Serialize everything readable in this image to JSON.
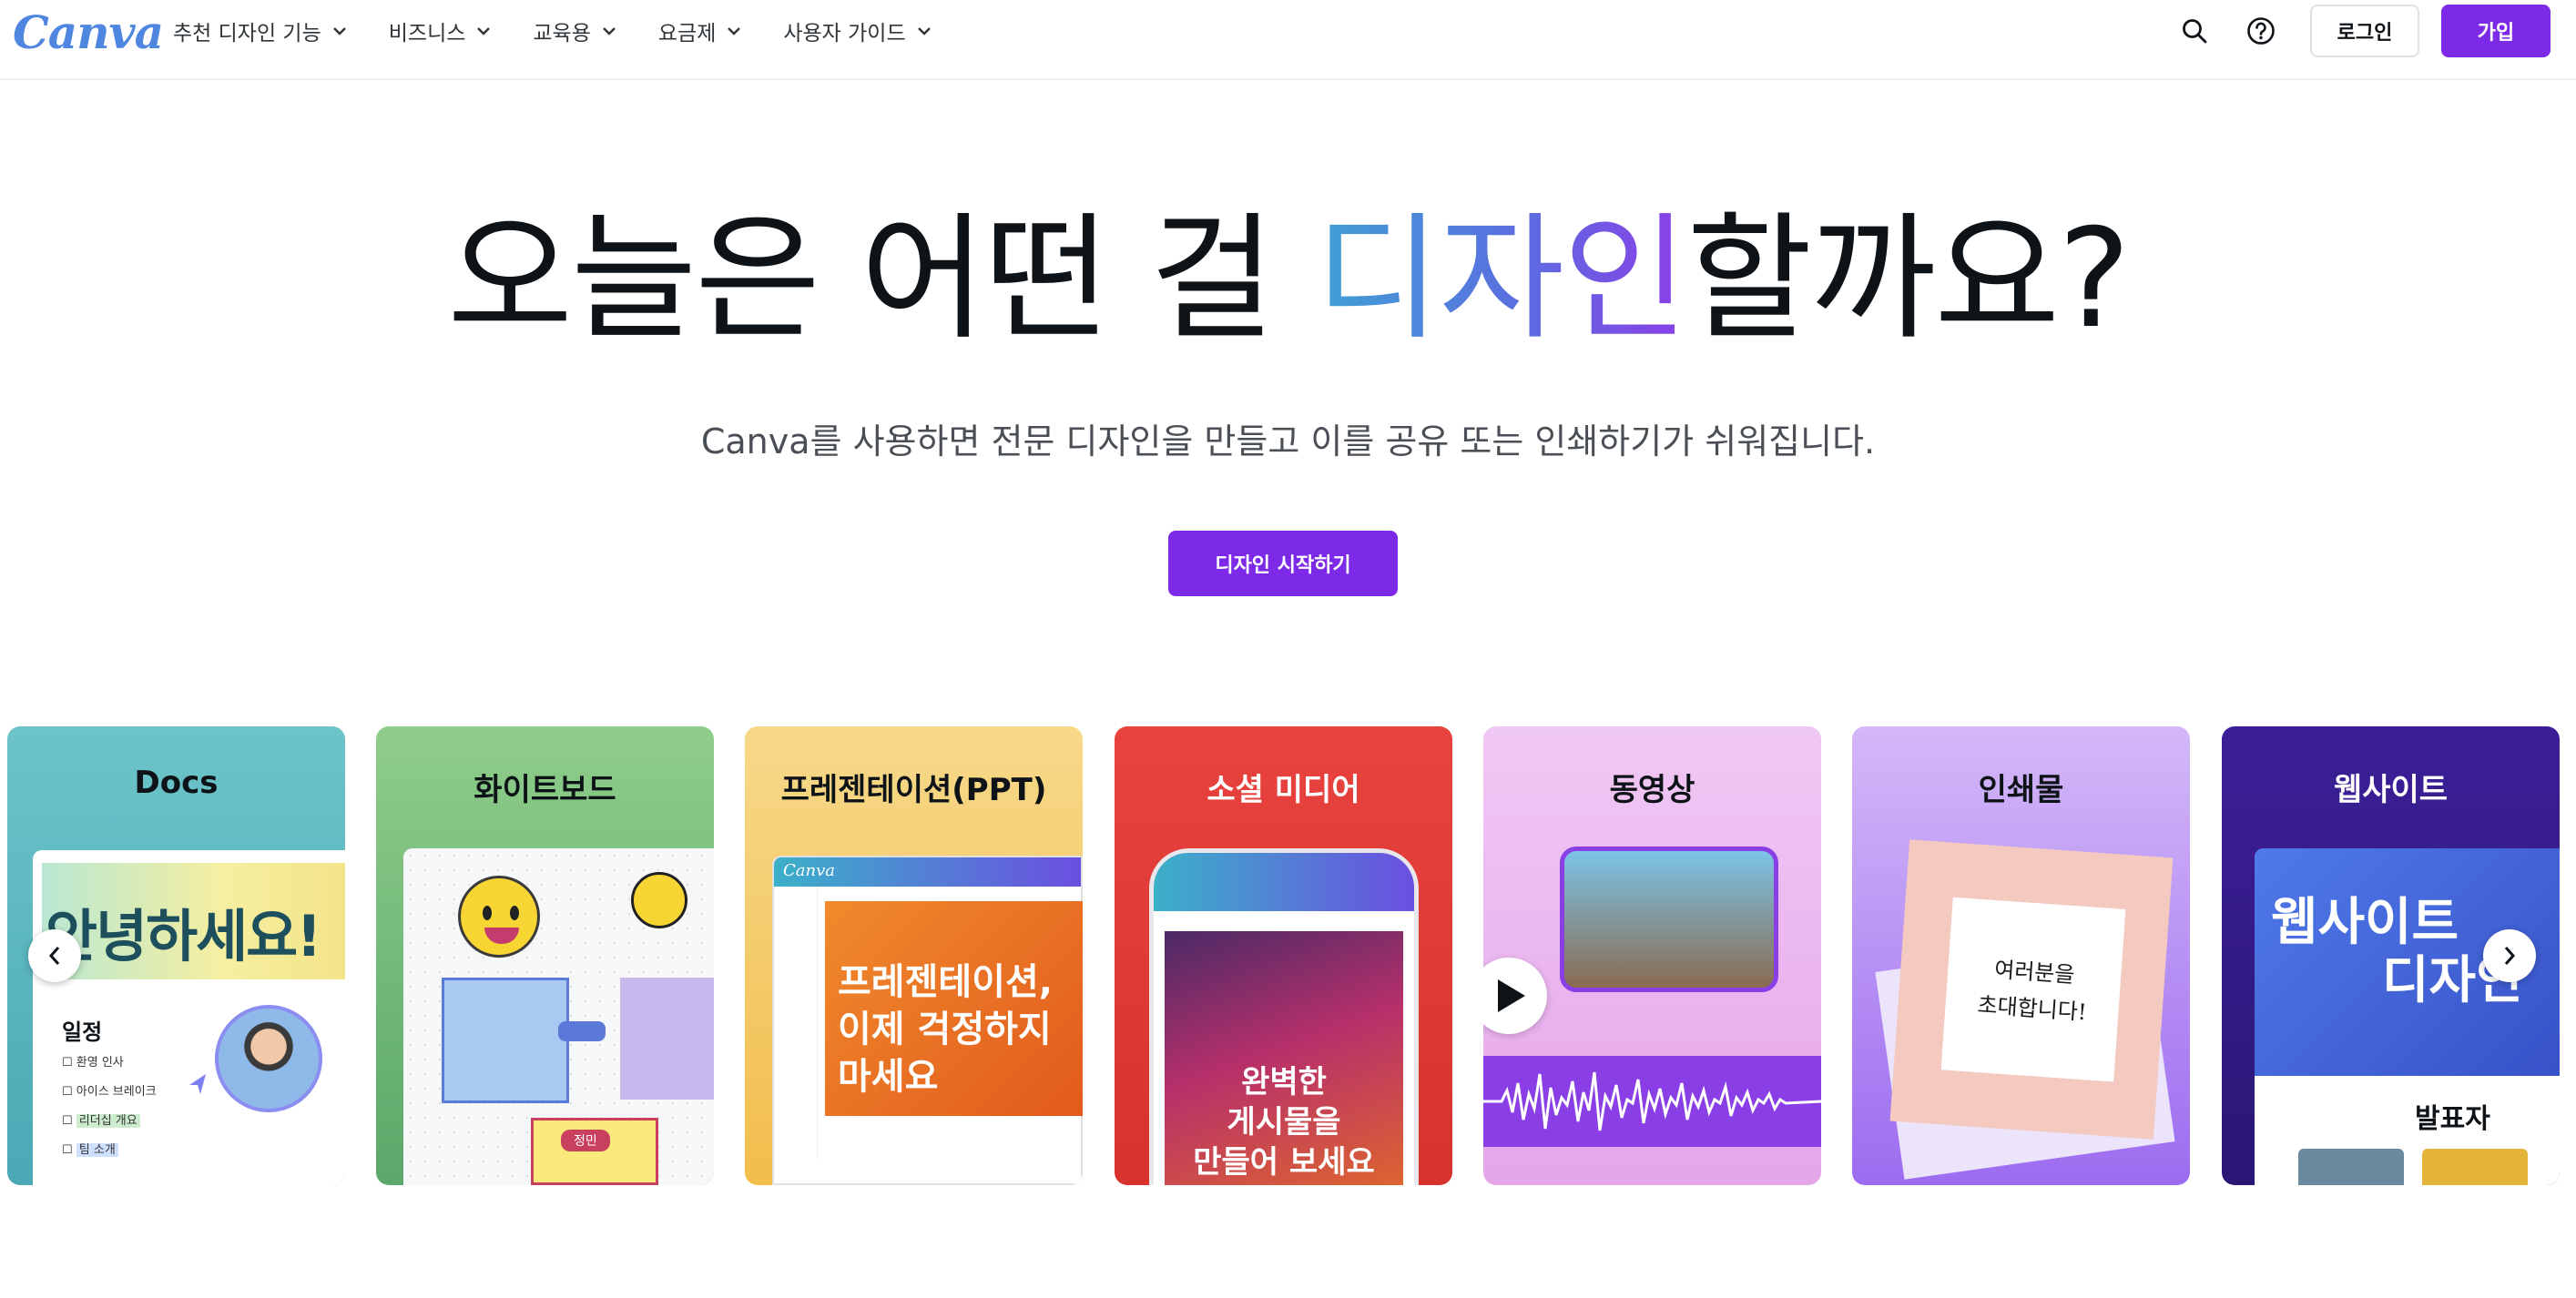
{
  "brand": {
    "logo_text": "Canva",
    "accent": "#7d2ae8",
    "logo_color": "#4f86e0"
  },
  "nav": {
    "items": [
      {
        "label": "추천 디자인 기능"
      },
      {
        "label": "비즈니스"
      },
      {
        "label": "교육용"
      },
      {
        "label": "요금제"
      },
      {
        "label": "사용자 가이드"
      }
    ],
    "search_icon": "search-icon",
    "help_icon": "help-icon",
    "login_label": "로그인",
    "signup_label": "가입"
  },
  "hero": {
    "title_before": "오늘은 어떤 걸 ",
    "title_highlight": "디자인",
    "title_after": "할까요?",
    "subtitle": "Canva를 사용하면 전문 디자인을 만들고 이를 공유 또는 인쇄하기가 쉬워집니다.",
    "cta_label": "디자인 시작하기"
  },
  "carousel": {
    "prev_icon": "chevron-left-icon",
    "next_icon": "chevron-right-icon",
    "cards": [
      {
        "title": "Docs",
        "color": "#6cc4c9",
        "greeting": "안녕하세요!",
        "schedule_heading": "일정",
        "schedule_items": [
          "환영 인사",
          "아이스 브레이크",
          "리더십 개요",
          "팀 소개"
        ]
      },
      {
        "title": "화이트보드",
        "color": "#8fcd8a",
        "note_label": "정민"
      },
      {
        "title": "프레젠테이션(PPT)",
        "color": "#f7d98a",
        "app_label": "Canva",
        "slide_text_1": "프레젠테이션,",
        "slide_text_2": "이제 걱정하지",
        "slide_text_3": "마세요"
      },
      {
        "title": "소셜 미디어",
        "color": "#e9433f",
        "post_text_1": "완벽한",
        "post_text_2": "게시물을",
        "post_text_3": "만들어 보세요"
      },
      {
        "title": "동영상",
        "color": "#ecb4ef"
      },
      {
        "title": "인쇄물",
        "color": "#c7a7f5",
        "invite_line_1": "여러분을",
        "invite_line_2": "초대합니다!"
      },
      {
        "title": "웹사이트",
        "color": "#3c1f98",
        "site_heading_1": "웹사이트",
        "site_heading_2": "디자인",
        "presenter_label": "발표자"
      }
    ]
  }
}
